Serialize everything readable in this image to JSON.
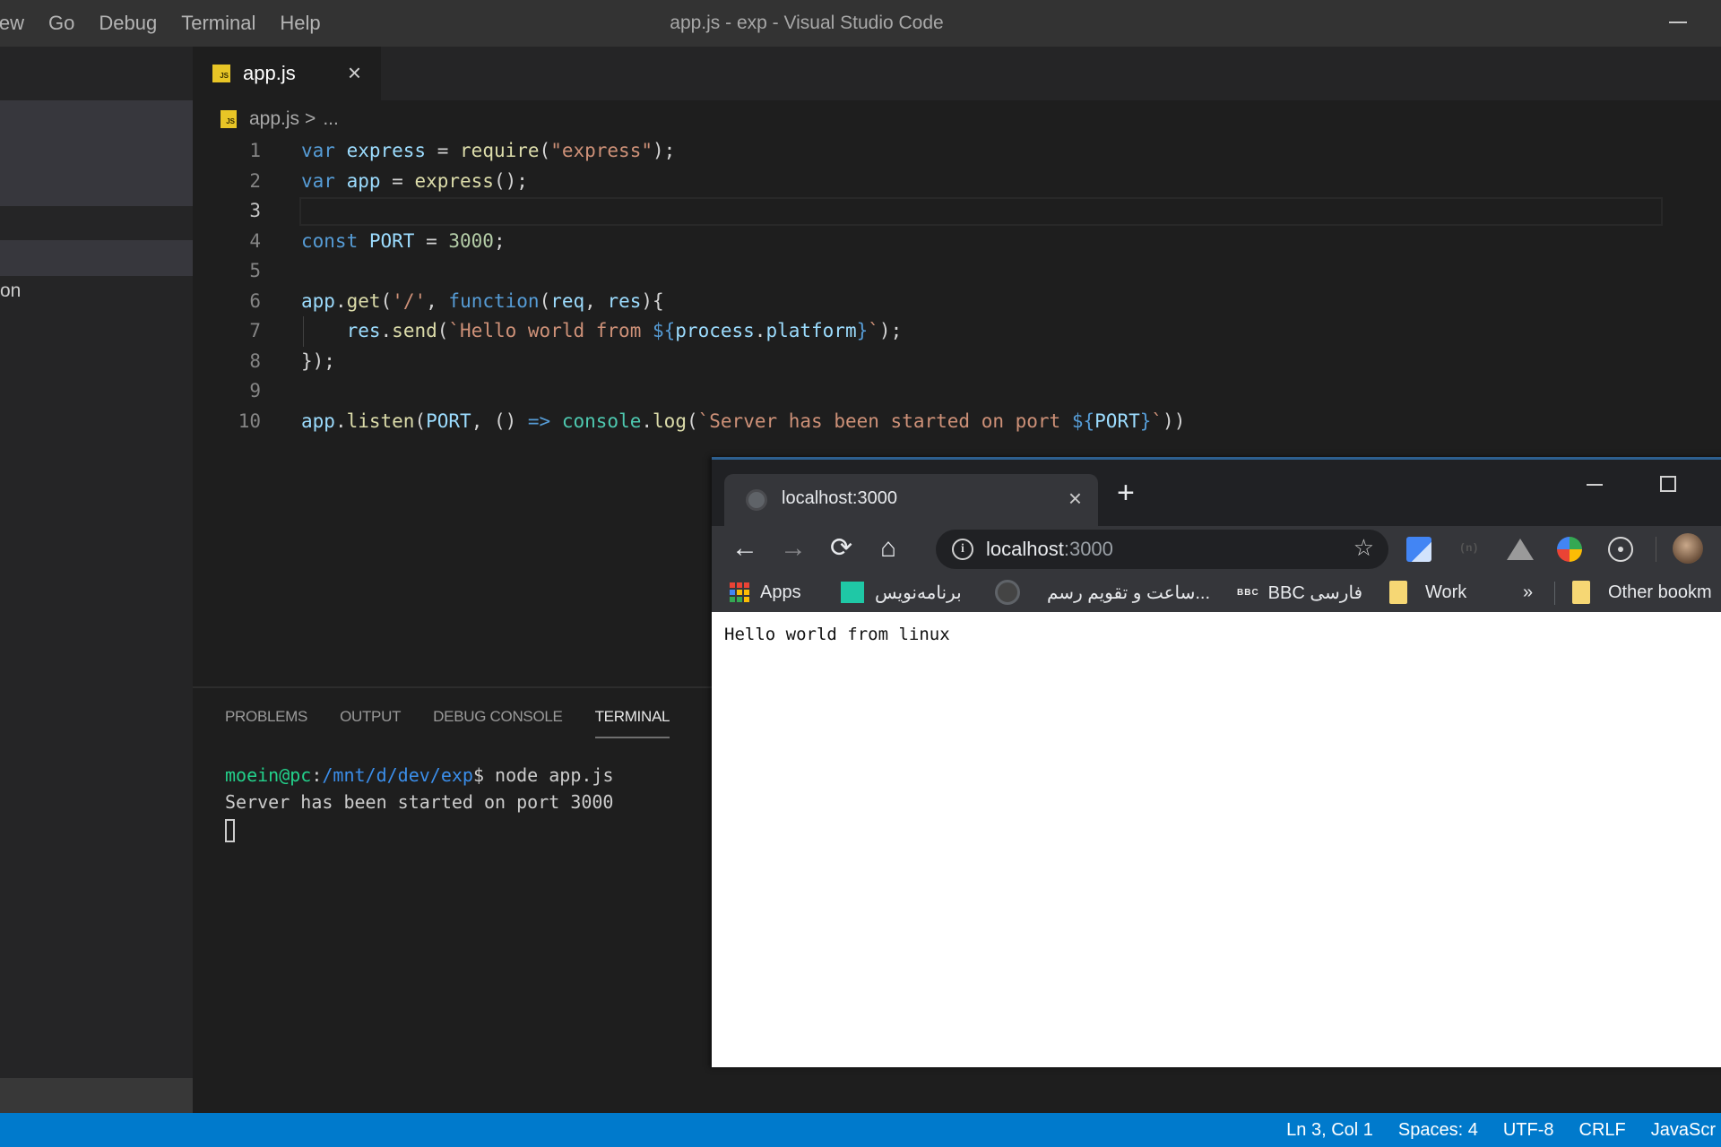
{
  "vscode": {
    "menu": [
      "iew",
      "Go",
      "Debug",
      "Terminal",
      "Help"
    ],
    "window_title": "app.js - exp - Visual Studio Code",
    "sidebar": {
      "partial_item_text": "on"
    },
    "tab": {
      "label": "app.js",
      "icon": "js-file-icon",
      "icon_text": "JS",
      "close_glyph": "×"
    },
    "breadcrumb": {
      "file": "app.js",
      "separator": ">",
      "more": "..."
    },
    "editor": {
      "current_line": 3,
      "lines": [
        {
          "n": "1",
          "tokens": [
            [
              "kw",
              "var "
            ],
            [
              "var",
              "express"
            ],
            [
              "op",
              " = "
            ],
            [
              "fn",
              "require"
            ],
            [
              "pun",
              "("
            ],
            [
              "str",
              "\"express\""
            ],
            [
              "pun",
              ");"
            ]
          ]
        },
        {
          "n": "2",
          "tokens": [
            [
              "kw",
              "var "
            ],
            [
              "var",
              "app"
            ],
            [
              "op",
              " = "
            ],
            [
              "fn",
              "express"
            ],
            [
              "pun",
              "();"
            ]
          ]
        },
        {
          "n": "3",
          "tokens": []
        },
        {
          "n": "4",
          "tokens": [
            [
              "kw",
              "const "
            ],
            [
              "var",
              "PORT"
            ],
            [
              "op",
              " = "
            ],
            [
              "num",
              "3000"
            ],
            [
              "pun",
              ";"
            ]
          ]
        },
        {
          "n": "5",
          "tokens": []
        },
        {
          "n": "6",
          "tokens": [
            [
              "var",
              "app"
            ],
            [
              "pun",
              "."
            ],
            [
              "fn",
              "get"
            ],
            [
              "pun",
              "("
            ],
            [
              "str",
              "'/'"
            ],
            [
              "pun",
              ", "
            ],
            [
              "kw",
              "function"
            ],
            [
              "pun",
              "("
            ],
            [
              "var",
              "req"
            ],
            [
              "pun",
              ", "
            ],
            [
              "var",
              "res"
            ],
            [
              "pun",
              "){"
            ]
          ]
        },
        {
          "n": "7",
          "tokens": [
            [
              "pun",
              "    "
            ],
            [
              "var",
              "res"
            ],
            [
              "pun",
              "."
            ],
            [
              "fn",
              "send"
            ],
            [
              "pun",
              "("
            ],
            [
              "str",
              "`Hello world from "
            ],
            [
              "kw",
              "${"
            ],
            [
              "var",
              "process"
            ],
            [
              "pun",
              "."
            ],
            [
              "var",
              "platform"
            ],
            [
              "kw",
              "}"
            ],
            [
              "str",
              "`"
            ],
            [
              "pun",
              ");"
            ]
          ]
        },
        {
          "n": "8",
          "tokens": [
            [
              "pun",
              "});"
            ]
          ]
        },
        {
          "n": "9",
          "tokens": []
        },
        {
          "n": "10",
          "tokens": [
            [
              "var",
              "app"
            ],
            [
              "pun",
              "."
            ],
            [
              "fn",
              "listen"
            ],
            [
              "pun",
              "("
            ],
            [
              "var",
              "PORT"
            ],
            [
              "pun",
              ", () "
            ],
            [
              "kw",
              "=>"
            ],
            [
              "pun",
              " "
            ],
            [
              "cls",
              "console"
            ],
            [
              "pun",
              "."
            ],
            [
              "fn",
              "log"
            ],
            [
              "pun",
              "("
            ],
            [
              "str",
              "`Server has been started on port "
            ],
            [
              "kw",
              "${"
            ],
            [
              "var",
              "PORT"
            ],
            [
              "kw",
              "}"
            ],
            [
              "str",
              "`"
            ],
            [
              "pun",
              "))"
            ]
          ]
        }
      ]
    },
    "panel": {
      "tabs": [
        "PROBLEMS",
        "OUTPUT",
        "DEBUG CONSOLE",
        "TERMINAL"
      ],
      "active_tab": "TERMINAL",
      "terminal": {
        "prompt_user": "moein@pc",
        "prompt_sep": ":",
        "prompt_path": "/mnt/d/dev/exp",
        "prompt_symbol": "$",
        "command": " node app.js",
        "output": "Server has been started on port 3000"
      }
    },
    "statusbar": {
      "position": "Ln 3, Col 1",
      "indent": "Spaces: 4",
      "encoding": "UTF-8",
      "eol": "CRLF",
      "language": "JavaScr"
    },
    "colors": {
      "statusbar": "#007acc",
      "editor_bg": "#1e1e1e",
      "sidebar_bg": "#252526"
    }
  },
  "browser": {
    "tab_title": "localhost:3000",
    "tab_close": "×",
    "new_tab": "+",
    "nav": {
      "back": "←",
      "forward": "→",
      "reload": "⟳",
      "home": "⌂"
    },
    "url_host": "localhost",
    "url_port": ":3000",
    "info_glyph": "i",
    "star_glyph": "☆",
    "extensions": [
      "google-translate-icon",
      "rss-icon",
      "google-drive-icon",
      "idm-icon",
      "react-devtools-icon"
    ],
    "bookmarks": [
      {
        "label": "Apps",
        "icon": "apps-grid-icon"
      },
      {
        "label": "برنامه‌نویس",
        "icon": "pro-favicon-icon"
      },
      {
        "label": "ساعت و تقویم رسم...",
        "icon": "clock-favicon-icon"
      },
      {
        "label": "BBC فارسی",
        "icon": "bbc-favicon-icon",
        "icon_text": "BBC"
      },
      {
        "label": "Work",
        "icon": "folder-icon"
      }
    ],
    "bookmarks_overflow": "»",
    "other_bookmarks": "Other bookm",
    "page_text": "Hello world from linux"
  }
}
